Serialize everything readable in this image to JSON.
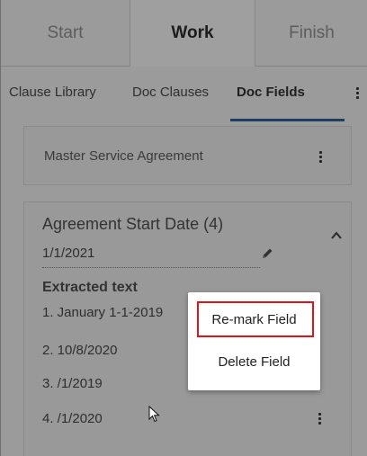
{
  "phase_tabs": [
    {
      "label": "Start"
    },
    {
      "label": "Work"
    },
    {
      "label": "Finish"
    }
  ],
  "sub_tabs": [
    {
      "label": "Clause Library"
    },
    {
      "label": "Doc Clauses"
    },
    {
      "label": "Doc Fields"
    }
  ],
  "master_card": {
    "title": "Master Service Agreement"
  },
  "field_card": {
    "title": "Agreement Start Date (4)",
    "value": "1/1/2021",
    "section_label": "Extracted text",
    "extracted_items": [
      "1. January 1-1-2019",
      "2. 10/8/2020",
      "3. /1/2019",
      "4. /1/2020"
    ]
  },
  "context_menu": {
    "items": [
      {
        "label": "Re-mark Field"
      },
      {
        "label": "Delete Field"
      }
    ]
  },
  "colors": {
    "highlight": "#e0141b",
    "active_underline": "#1f3f62"
  }
}
